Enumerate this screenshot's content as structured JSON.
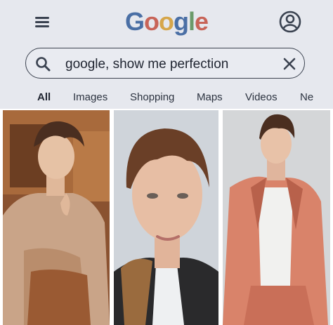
{
  "header": {
    "logo": {
      "letters": [
        "G",
        "o",
        "o",
        "g",
        "l",
        "e"
      ],
      "colors": [
        "#4a6fa5",
        "#c86458",
        "#d6a64a",
        "#4a6fa5",
        "#6b9a6a",
        "#c86458"
      ]
    },
    "menu_icon": "hamburger-menu-icon",
    "account_icon": "account-circle-icon"
  },
  "search": {
    "query": "google, show me perfection",
    "search_icon": "search-icon",
    "clear_icon": "close-icon"
  },
  "tabs": [
    {
      "label": "All",
      "active": true
    },
    {
      "label": "Images",
      "active": false
    },
    {
      "label": "Shopping",
      "active": false
    },
    {
      "label": "Maps",
      "active": false
    },
    {
      "label": "Videos",
      "active": false
    },
    {
      "label": "Ne",
      "active": false
    }
  ],
  "results": [
    {
      "description": "young man in beige knit top, curly brown hair, wooden background"
    },
    {
      "description": "close-up portrait of young man with tousled brown hair"
    },
    {
      "description": "young man in salmon pink suit with white tank top"
    }
  ],
  "colors": {
    "header_bg": "#e6e8ee",
    "text": "#1f2430",
    "icon": "#3a4250"
  }
}
